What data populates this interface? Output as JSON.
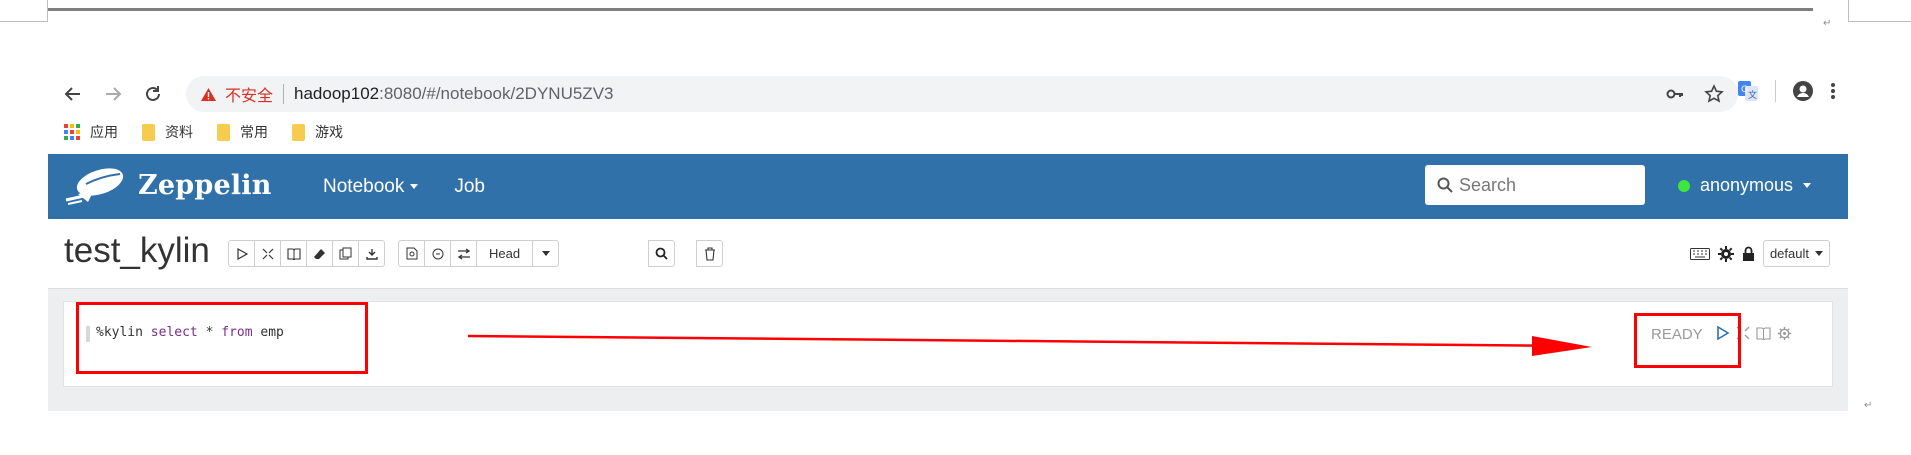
{
  "browser": {
    "security_label": "不安全",
    "url_host": "hadoop102",
    "url_rest": ":8080/#/notebook/2DYNU5ZV3",
    "bookmarks": [
      {
        "label": "应用",
        "icon": "apps-grid-icon"
      },
      {
        "label": "资料",
        "icon": "folder-icon"
      },
      {
        "label": "常用",
        "icon": "folder-icon"
      },
      {
        "label": "游戏",
        "icon": "folder-icon"
      }
    ]
  },
  "navbar": {
    "brand": "Zeppelin",
    "menu": [
      {
        "label": "Notebook",
        "dropdown": true
      },
      {
        "label": "Job",
        "dropdown": false
      }
    ],
    "search_placeholder": "Search",
    "user": "anonymous",
    "color": "#3071a9"
  },
  "notebook": {
    "title": "test_kylin",
    "head_label": "Head",
    "interpreter": "default"
  },
  "paragraph": {
    "code_prefix": "%kylin ",
    "code_kw1": "select",
    "code_mid": " * ",
    "code_kw2": "from",
    "code_end": " emp",
    "status": "READY"
  },
  "annotation_color": "#ff0000"
}
